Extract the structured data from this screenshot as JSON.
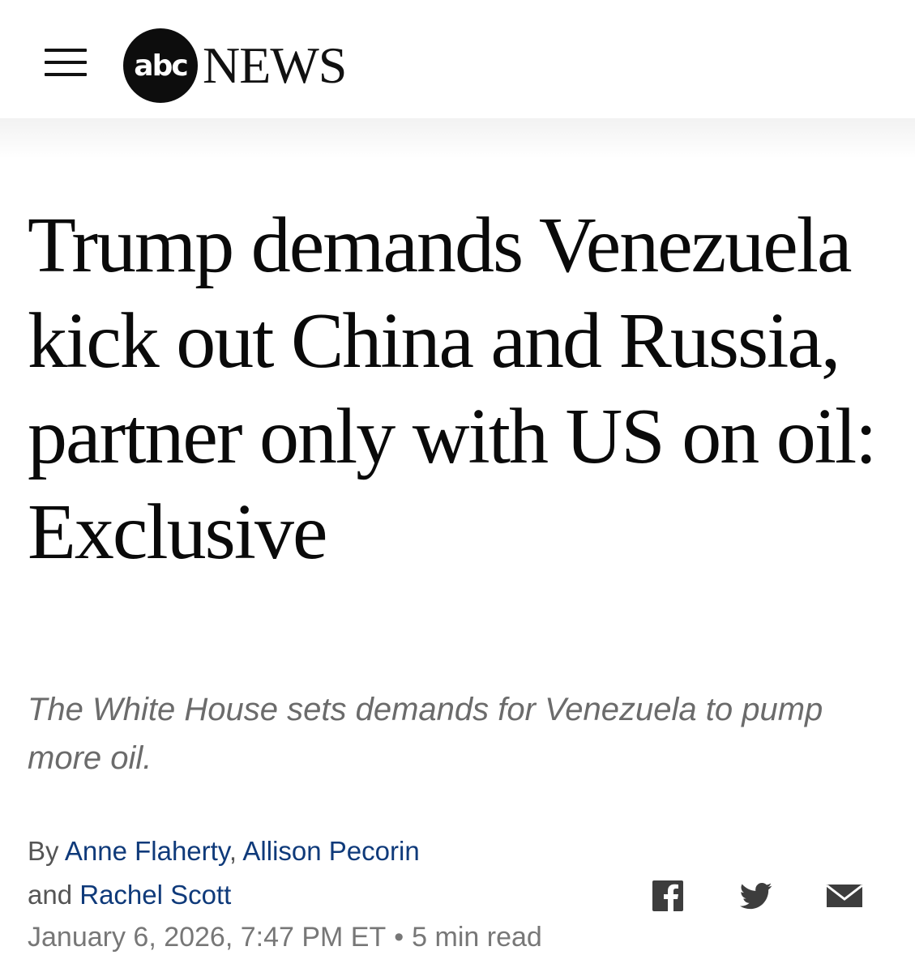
{
  "header": {
    "logo_mark": "abc",
    "logo_text": "NEWS",
    "menu_icon": "hamburger-menu-icon"
  },
  "article": {
    "headline": "Trump demands Venezuela kick out China and Russia, partner only with US on oil: Exclusive",
    "subheadline": "The White House sets demands for Venezuela to pump more oil.",
    "byline": {
      "prefix": "By",
      "authors": [
        "Anne Flaherty",
        "Allison Pecorin",
        "Rachel Scott"
      ],
      "separator": ",",
      "conjunction": "and"
    },
    "date": "January 6, 2026, 7:47 PM ET",
    "bullet": "•",
    "read_time": "5 min read"
  },
  "share": {
    "icons": [
      "facebook-icon",
      "twitter-icon",
      "email-icon"
    ]
  },
  "colors": {
    "author_link": "#0f3a7a",
    "headline": "#0a0a0a",
    "subheadline": "#6b6b6b",
    "meta": "#777777"
  }
}
